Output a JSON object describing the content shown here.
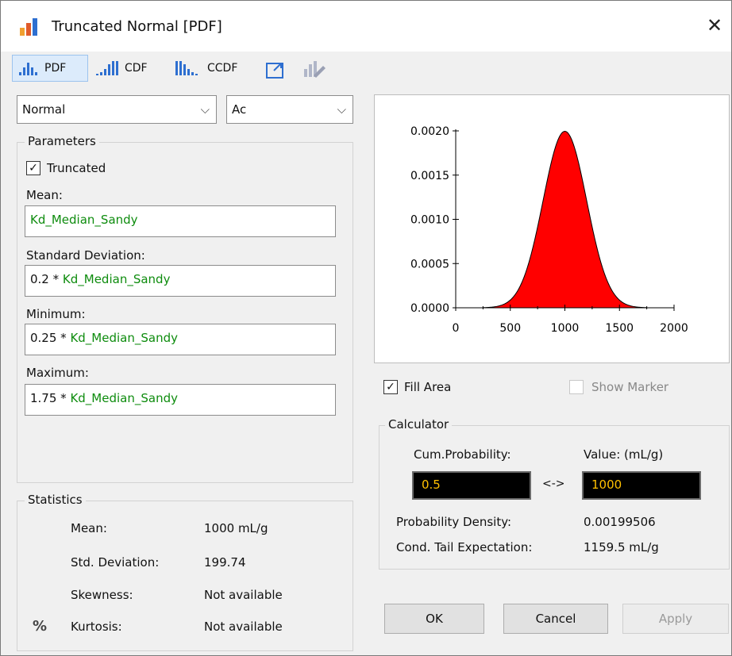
{
  "window": {
    "title": "Truncated Normal [PDF]"
  },
  "toolbar": {
    "pdf_label": "PDF",
    "cdf_label": "CDF",
    "ccdf_label": "CCDF"
  },
  "selectors": {
    "distribution": "Normal",
    "mode": "Ac"
  },
  "parameters": {
    "group_label": "Parameters",
    "truncated_label": "Truncated",
    "truncated_checked": true,
    "mean_label": "Mean:",
    "mean_value": "Kd_Median_Sandy",
    "std_label": "Standard Deviation:",
    "std_prefix": "0.2 * ",
    "std_expr": "Kd_Median_Sandy",
    "min_label": "Minimum:",
    "min_prefix": "0.25 * ",
    "min_expr": "Kd_Median_Sandy",
    "max_label": "Maximum:",
    "max_prefix": "1.75 * ",
    "max_expr": "Kd_Median_Sandy"
  },
  "statistics": {
    "group_label": "Statistics",
    "percent_symbol": "%",
    "rows": [
      {
        "label": "Mean:",
        "value": "1000 mL/g"
      },
      {
        "label": "Std. Deviation:",
        "value": "199.74"
      },
      {
        "label": "Skewness:",
        "value": "Not available"
      },
      {
        "label": "Kurtosis:",
        "value": "Not available"
      }
    ]
  },
  "options": {
    "fill_area_label": "Fill Area",
    "fill_area_checked": true,
    "show_marker_label": "Show Marker",
    "show_marker_checked": false
  },
  "calculator": {
    "group_label": "Calculator",
    "cum_prob_label": "Cum.Probability:",
    "value_label": "Value: (mL/g)",
    "cum_prob_value": "0.5",
    "value_value": "1000",
    "arrow": "<->",
    "density_label": "Probability Density:",
    "density_value": "0.00199506",
    "cte_label": "Cond. Tail Expectation:",
    "cte_value": "1159.5 mL/g"
  },
  "buttons": {
    "ok": "OK",
    "cancel": "Cancel",
    "apply": "Apply"
  },
  "chart_data": {
    "type": "area",
    "distribution": "truncated normal",
    "mean": 1000,
    "std": 200,
    "truncation": [
      250,
      1750
    ],
    "xlim": [
      0,
      2000
    ],
    "ylim": [
      0,
      0.002
    ],
    "xticks": [
      "0",
      "500",
      "1000",
      "1500",
      "2000"
    ],
    "yticks": [
      "0.0000",
      "0.0005",
      "0.0010",
      "0.0015",
      "0.0020"
    ],
    "fill_color": "#ff0000",
    "grid": false
  }
}
